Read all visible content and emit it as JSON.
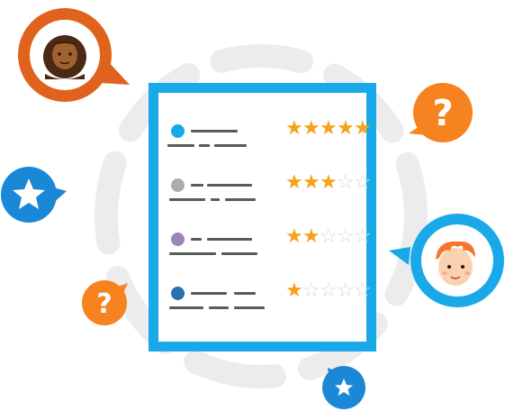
{
  "review_card": {
    "rows": [
      {
        "dot_color": "#1aa9e8",
        "rating": 5,
        "max": 5
      },
      {
        "dot_color": "#a9adb0",
        "rating": 3,
        "max": 5
      },
      {
        "dot_color": "#9c86b8",
        "rating": 2,
        "max": 5
      },
      {
        "dot_color": "#2a6fb0",
        "rating": 1,
        "max": 5
      }
    ]
  },
  "bubbles": {
    "top_left_avatar": {
      "icon": "woman-avatar-icon",
      "color": "#e0621c"
    },
    "right_avatar": {
      "icon": "boy-avatar-icon",
      "color": "#1aa9e8"
    },
    "top_right": {
      "icon": "question-icon",
      "glyph": "?",
      "color": "#f6831f"
    },
    "bottom_left": {
      "icon": "question-icon",
      "glyph": "?",
      "color": "#f6831f"
    },
    "left": {
      "icon": "star-icon",
      "color": "#1a88d6"
    },
    "bottom": {
      "icon": "star-icon",
      "color": "#1a88d6"
    }
  },
  "colors": {
    "accent_blue": "#1aa9e8",
    "star_gold": "#f6a21a",
    "orange": "#f6831f",
    "ring_gray": "#ececec"
  }
}
